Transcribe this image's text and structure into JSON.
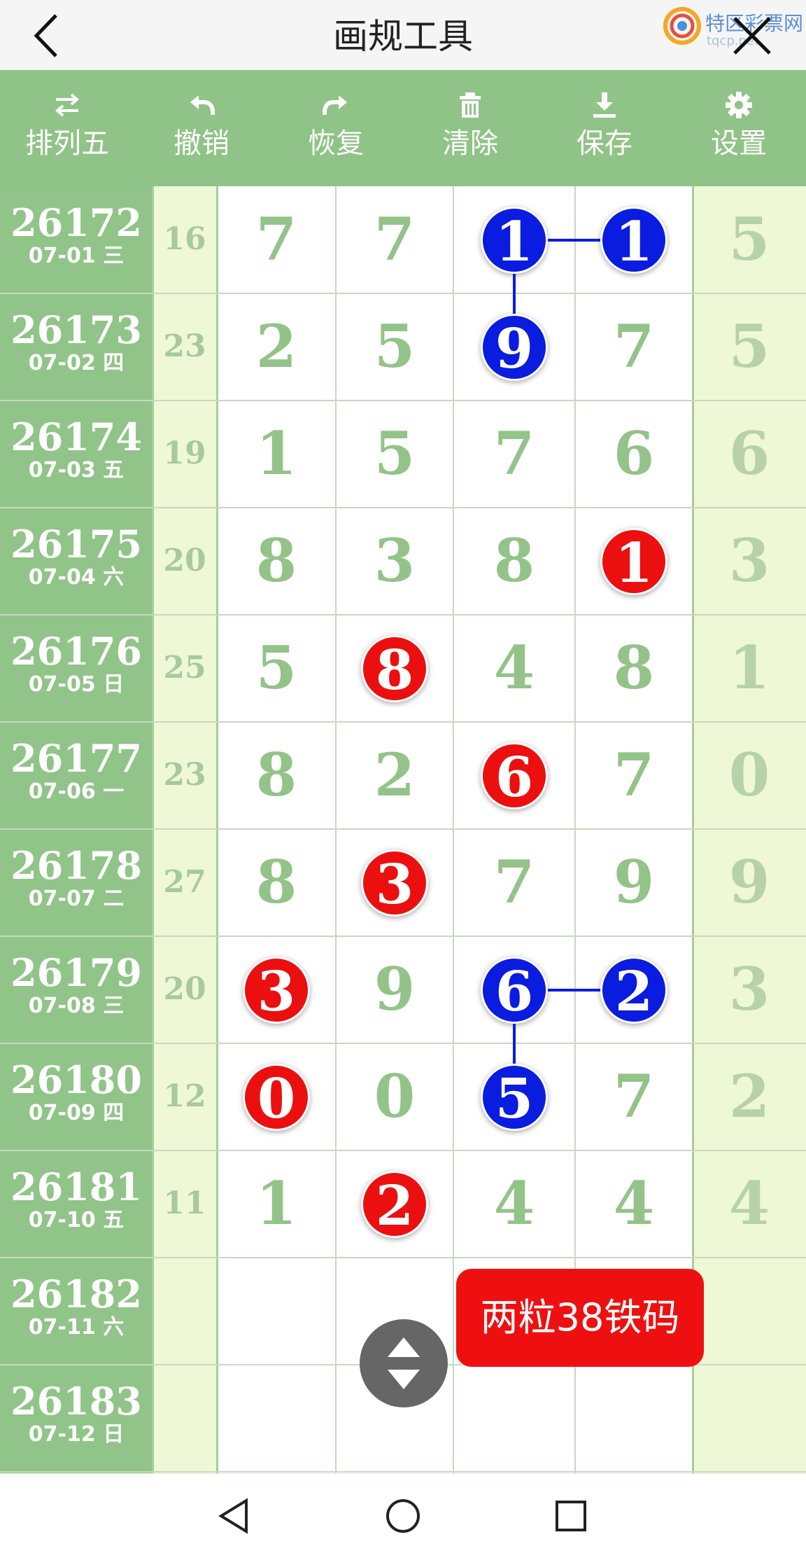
{
  "header": {
    "title": "画规工具",
    "logo_text": "特区彩票网",
    "logo_url": "tqcp.net"
  },
  "toolbar": {
    "items": [
      {
        "label": "排列五",
        "icon": "swap-arrows-icon"
      },
      {
        "label": "撤销",
        "icon": "undo-icon"
      },
      {
        "label": "恢复",
        "icon": "redo-icon"
      },
      {
        "label": "清除",
        "icon": "trash-icon"
      },
      {
        "label": "保存",
        "icon": "download-icon"
      },
      {
        "label": "设置",
        "icon": "gear-icon"
      }
    ]
  },
  "rows": [
    {
      "period": "26172",
      "date": "07-01 三",
      "sum": "16",
      "digits": [
        "7",
        "7",
        "1",
        "1",
        "5"
      ],
      "balls": [
        null,
        null,
        "blue",
        "blue",
        null
      ]
    },
    {
      "period": "26173",
      "date": "07-02 四",
      "sum": "23",
      "digits": [
        "2",
        "5",
        "9",
        "7",
        "5"
      ],
      "balls": [
        null,
        null,
        "blue",
        null,
        null
      ]
    },
    {
      "period": "26174",
      "date": "07-03 五",
      "sum": "19",
      "digits": [
        "1",
        "5",
        "7",
        "6",
        "6"
      ],
      "balls": [
        null,
        null,
        null,
        null,
        null
      ]
    },
    {
      "period": "26175",
      "date": "07-04 六",
      "sum": "20",
      "digits": [
        "8",
        "3",
        "8",
        "1",
        "3"
      ],
      "balls": [
        null,
        null,
        null,
        "red",
        null
      ]
    },
    {
      "period": "26176",
      "date": "07-05 日",
      "sum": "25",
      "digits": [
        "5",
        "8",
        "4",
        "8",
        "1"
      ],
      "balls": [
        null,
        "red",
        null,
        null,
        null
      ]
    },
    {
      "period": "26177",
      "date": "07-06 一",
      "sum": "23",
      "digits": [
        "8",
        "2",
        "6",
        "7",
        "0"
      ],
      "balls": [
        null,
        null,
        "red",
        null,
        null
      ]
    },
    {
      "period": "26178",
      "date": "07-07 二",
      "sum": "27",
      "digits": [
        "8",
        "3",
        "7",
        "9",
        "9"
      ],
      "balls": [
        null,
        "red",
        null,
        null,
        null
      ]
    },
    {
      "period": "26179",
      "date": "07-08 三",
      "sum": "20",
      "digits": [
        "3",
        "9",
        "6",
        "2",
        "3"
      ],
      "balls": [
        "red",
        null,
        "blue",
        "blue",
        null
      ]
    },
    {
      "period": "26180",
      "date": "07-09 四",
      "sum": "12",
      "digits": [
        "0",
        "0",
        "5",
        "7",
        "2"
      ],
      "balls": [
        "red",
        null,
        "blue",
        null,
        null
      ]
    },
    {
      "period": "26181",
      "date": "07-10 五",
      "sum": "11",
      "digits": [
        "1",
        "2",
        "4",
        "4",
        "4"
      ],
      "balls": [
        null,
        "red",
        null,
        null,
        null
      ]
    },
    {
      "period": "26182",
      "date": "07-11 六",
      "sum": "",
      "digits": [
        "",
        "",
        "",
        "",
        ""
      ],
      "balls": [
        null,
        null,
        null,
        null,
        null
      ]
    },
    {
      "period": "26183",
      "date": "07-12 日",
      "sum": "",
      "digits": [
        "",
        "",
        "",
        "",
        ""
      ],
      "balls": [
        null,
        null,
        null,
        null,
        null
      ]
    }
  ],
  "tag": {
    "text": "两粒38铁码"
  },
  "colors": {
    "toolbar": "#90c387",
    "ball_red": "#ec0f0f",
    "ball_blue": "#0a1ce0",
    "tag": "#ee1010"
  }
}
